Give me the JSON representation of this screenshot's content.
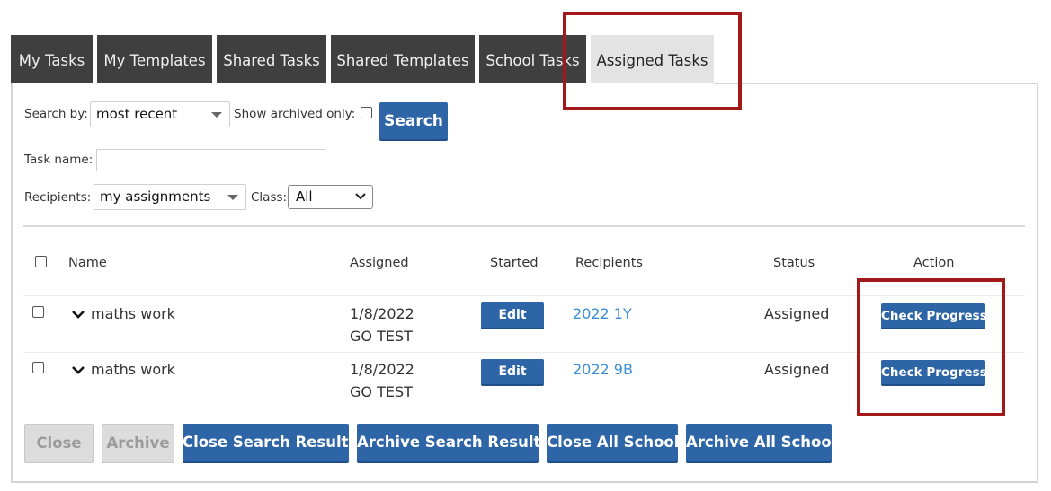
{
  "tabs": [
    {
      "label": "My Tasks"
    },
    {
      "label": "My Templates"
    },
    {
      "label": "Shared Tasks"
    },
    {
      "label": "Shared Templates"
    },
    {
      "label": "School Tasks"
    },
    {
      "label": "Assigned Tasks"
    }
  ],
  "filters": {
    "search_by_label": "Search by:",
    "search_by_value": "most recent",
    "show_archived_label": "Show archived only:",
    "search_button": "Search",
    "task_name_label": "Task name:",
    "task_name_value": "",
    "recipients_label": "Recipients:",
    "recipients_value": "my assignments",
    "class_label": "Class:",
    "class_value": "All"
  },
  "table": {
    "headers": {
      "name": "Name",
      "assigned": "Assigned",
      "started": "Started",
      "recipients": "Recipients",
      "status": "Status",
      "action": "Action"
    },
    "rows": [
      {
        "name": "maths work",
        "assigned_date": "1/8/2022",
        "assigned_by": "GO TEST",
        "started_button": "Edit",
        "recipients": "2022 1Y",
        "status": "Assigned",
        "action_button": "Check Progress"
      },
      {
        "name": "maths work",
        "assigned_date": "1/8/2022",
        "assigned_by": "GO TEST",
        "started_button": "Edit",
        "recipients": "2022 9B",
        "status": "Assigned",
        "action_button": "Check Progress"
      }
    ]
  },
  "footer_buttons": {
    "close": "Close",
    "archive": "Archive",
    "close_search_results": "Close Search Results",
    "archive_search_results": "Archive Search Results",
    "close_all_school": "Close All School",
    "archive_all_school": "Archive All School"
  },
  "colors": {
    "tab_dark": "#3f3f3f",
    "tab_active": "#e3e3e3",
    "button_blue": "#2d65a7",
    "link_blue": "#3a8fd6",
    "highlight_red": "#a31818"
  }
}
